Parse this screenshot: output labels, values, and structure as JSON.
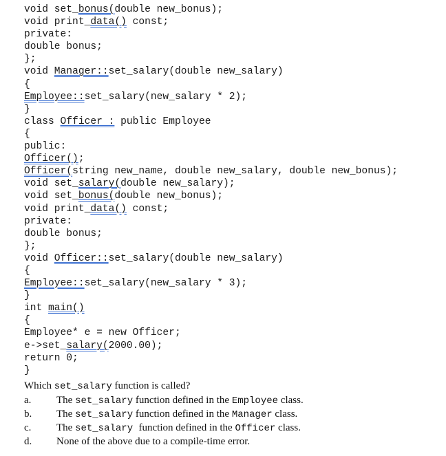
{
  "code_lines": [
    {
      "pre": "void set_",
      "sq": "bonus(",
      "post": "double new_bonus);"
    },
    {
      "pre": "void print_",
      "sq": "data()",
      "post": " const;"
    },
    {
      "pre": "private:",
      "sq": "",
      "post": ""
    },
    {
      "pre": "double bonus;",
      "sq": "",
      "post": ""
    },
    {
      "pre": "};",
      "sq": "",
      "post": ""
    },
    {
      "pre": "void ",
      "sq": "Manager::",
      "post": "set_salary(double new_salary)"
    },
    {
      "pre": "{",
      "sq": "",
      "post": ""
    },
    {
      "pre": "",
      "sq": "Employee::",
      "post": "set_salary(new_salary * 2);"
    },
    {
      "pre": "}",
      "sq": "",
      "post": ""
    },
    {
      "pre": "class ",
      "sq": "Officer :",
      "post": " public Employee"
    },
    {
      "pre": "{",
      "sq": "",
      "post": ""
    },
    {
      "pre": "public:",
      "sq": "",
      "post": ""
    },
    {
      "pre": "",
      "sq": "Officer()",
      "post": ";"
    },
    {
      "pre": "",
      "sq": "Officer(",
      "post": "string new_name, double new_salary, double new_bonus);"
    },
    {
      "pre": "void set_",
      "sq": "salary(",
      "post": "double new_salary);"
    },
    {
      "pre": "void set_",
      "sq": "bonus(",
      "post": "double new_bonus);"
    },
    {
      "pre": "void print_",
      "sq": "data()",
      "post": " const;"
    },
    {
      "pre": "private:",
      "sq": "",
      "post": ""
    },
    {
      "pre": "double bonus;",
      "sq": "",
      "post": ""
    },
    {
      "pre": "};",
      "sq": "",
      "post": ""
    },
    {
      "pre": "void ",
      "sq": "Officer::",
      "post": "set_salary(double new_salary)"
    },
    {
      "pre": "{",
      "sq": "",
      "post": ""
    },
    {
      "pre": "",
      "sq": "Employee::",
      "post": "set_salary(new_salary * 3);"
    },
    {
      "pre": "}",
      "sq": "",
      "post": ""
    },
    {
      "pre": "int ",
      "sq": "main()",
      "post": ""
    },
    {
      "pre": "{",
      "sq": "",
      "post": ""
    },
    {
      "pre": "Employee* e = new Officer;",
      "sq": "",
      "post": ""
    },
    {
      "pre": "e->set_",
      "sq": "salary(",
      "post": "2000.00);"
    },
    {
      "pre": "return 0;",
      "sq": "",
      "post": ""
    },
    {
      "pre": "}",
      "sq": "",
      "post": ""
    }
  ],
  "question": {
    "prefix": "Which ",
    "code": "set_salary",
    "suffix": " function is called?"
  },
  "options": [
    {
      "letter": "a.",
      "t1": "The ",
      "c1": "set_salary",
      "t2": " function defined in the ",
      "c2": "Employee",
      "t3": " class."
    },
    {
      "letter": "b.",
      "t1": "The ",
      "c1": "set_salary",
      "t2": " function defined in the ",
      "c2": "Manager",
      "t3": " class."
    },
    {
      "letter": "c.",
      "t1": "The ",
      "c1": "set_salary ",
      "t2": " function defined in the ",
      "c2": "Officer",
      "t3": " class."
    },
    {
      "letter": "d.",
      "t1": "None of the above due to a compile-time error.",
      "c1": "",
      "t2": "",
      "c2": "",
      "t3": ""
    }
  ],
  "colors": {
    "squiggle_underline": "#3b6fd1",
    "text": "#111111"
  }
}
